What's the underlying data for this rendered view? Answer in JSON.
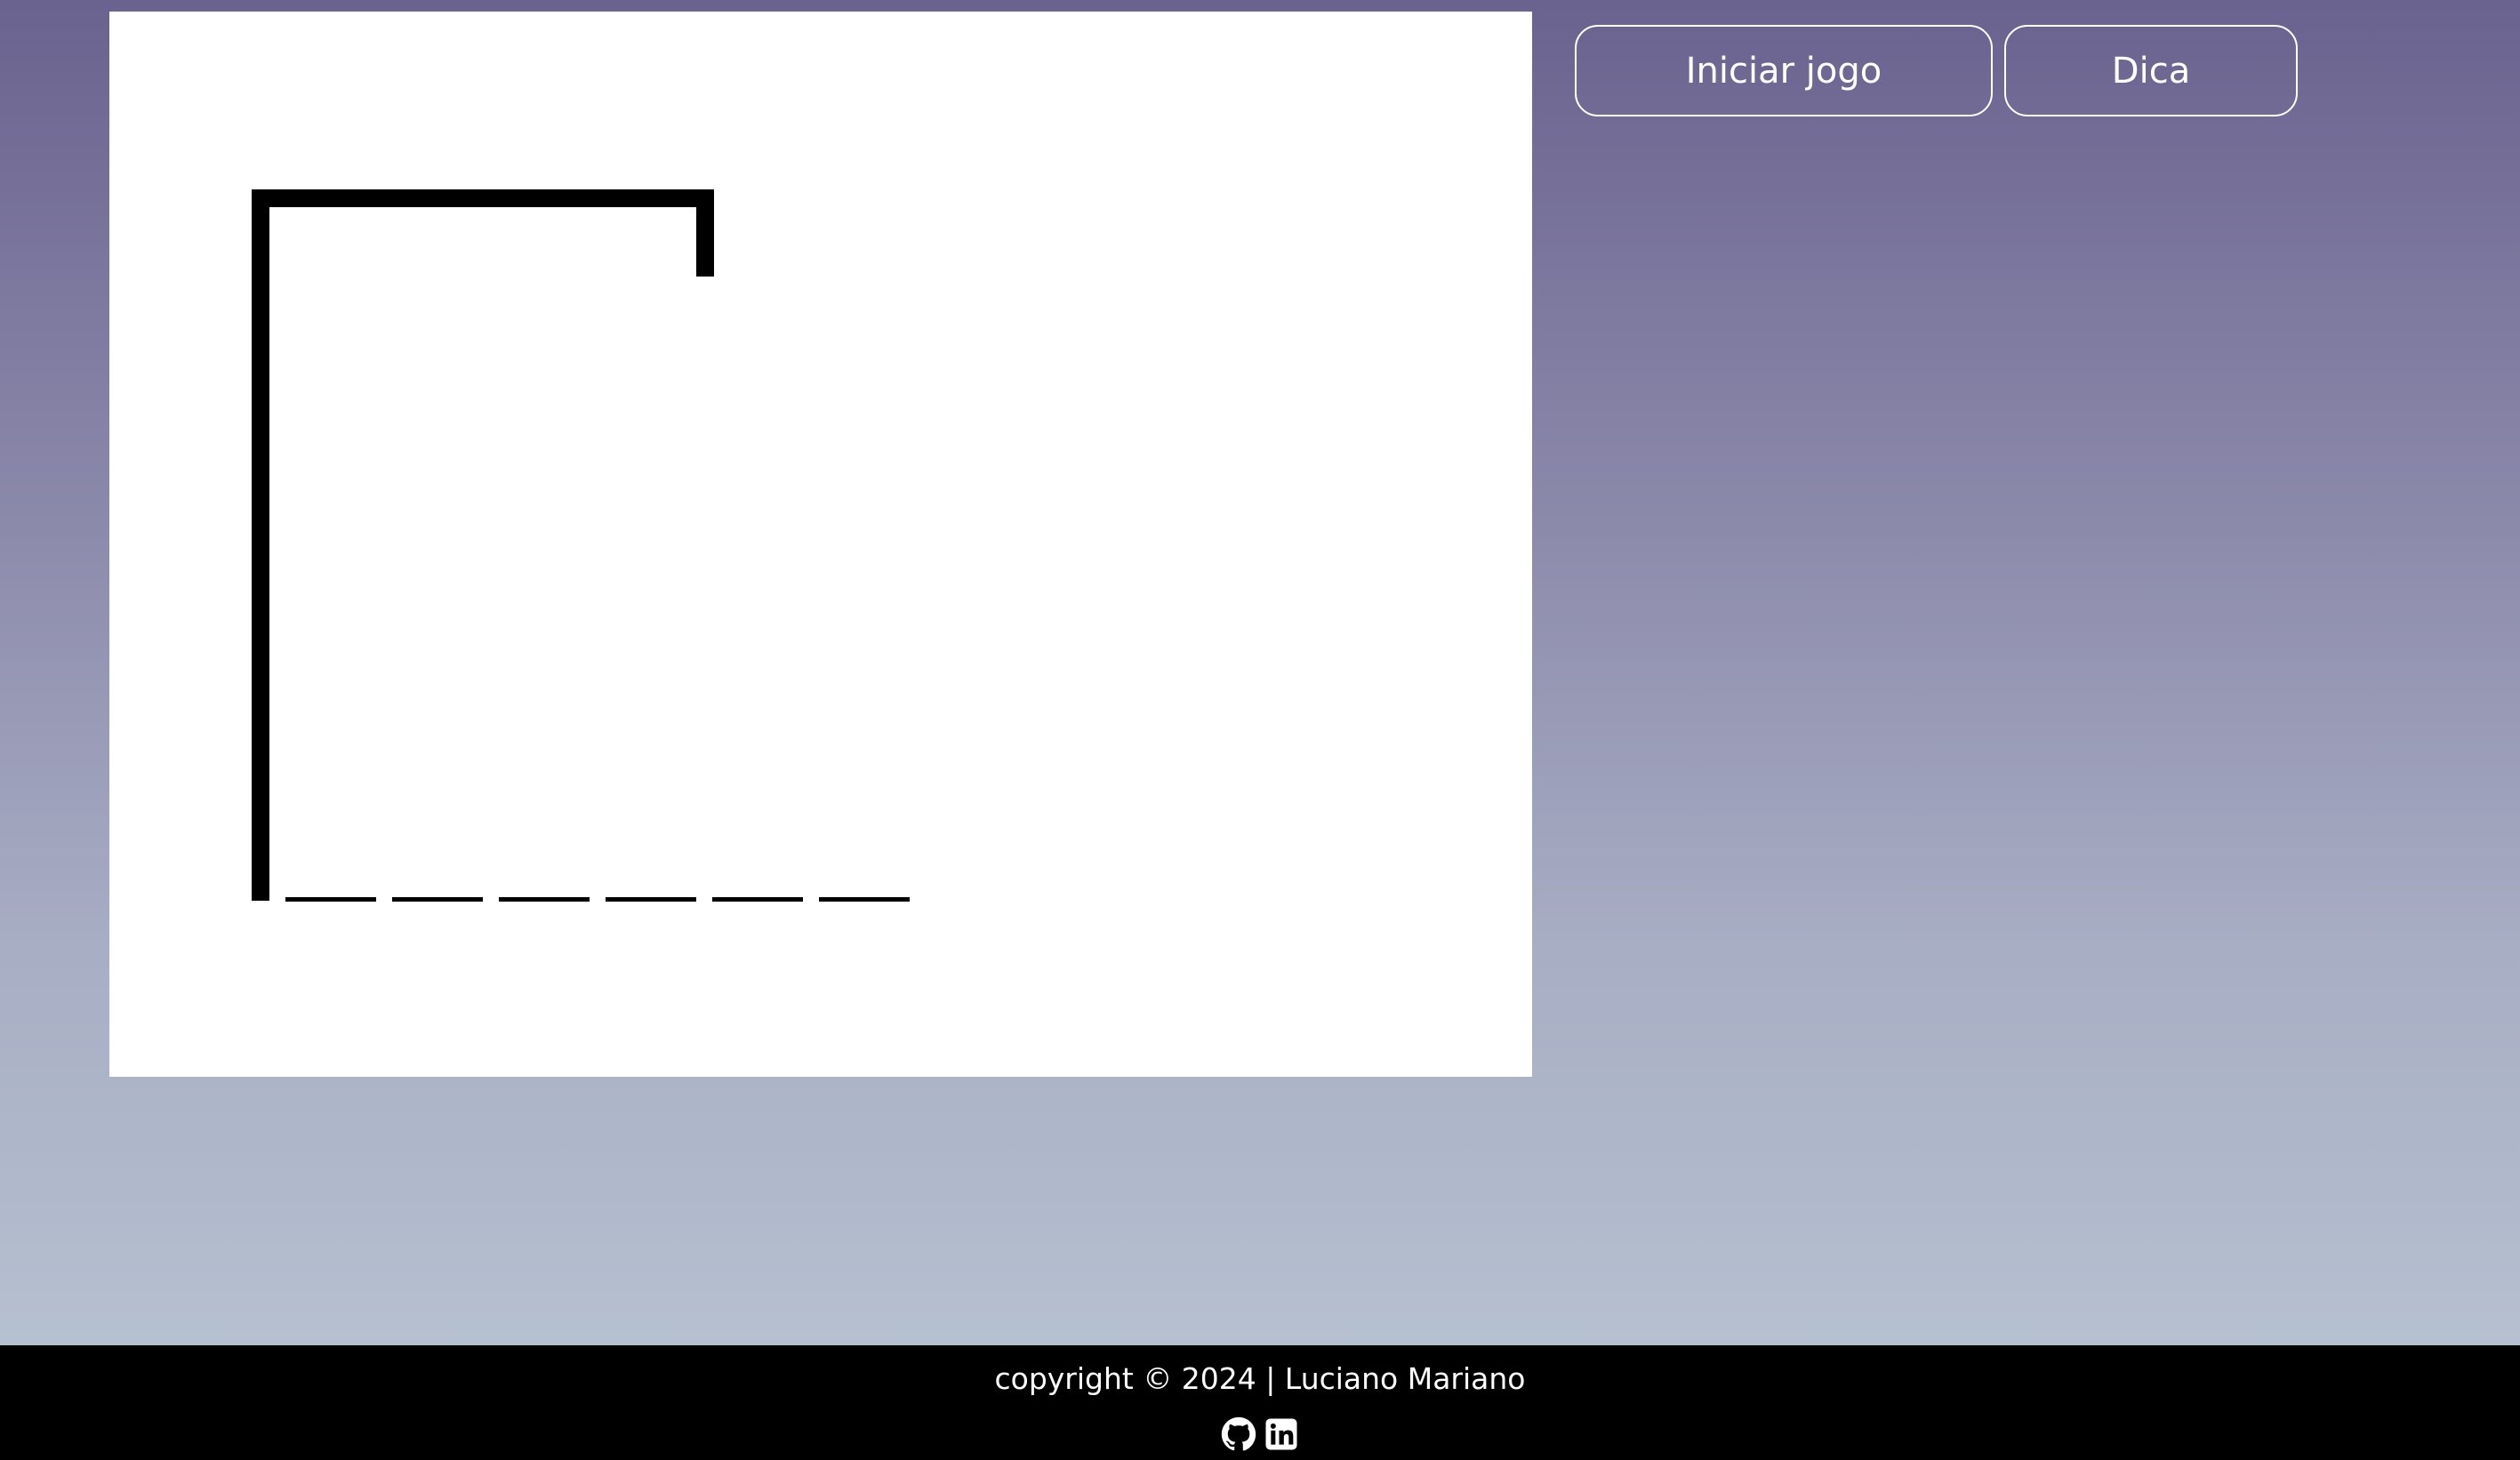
{
  "game": {
    "word_length": 6,
    "revealed_letters": [
      "",
      "",
      "",
      "",
      "",
      ""
    ]
  },
  "controls": {
    "start_label": "Iniciar jogo",
    "hint_label": "Dica"
  },
  "footer": {
    "copyright": "copyright © 2024 | Luciano Mariano",
    "social": [
      {
        "icon": "github-icon"
      },
      {
        "icon": "linkedin-icon"
      }
    ]
  },
  "colors": {
    "background_top": "#6a628f",
    "background_bottom": "#b9c5d3",
    "canvas": "#ffffff",
    "footer": "#000000",
    "button_border": "#ffffff",
    "text_light": "#ffffff",
    "drawing": "#000000"
  }
}
